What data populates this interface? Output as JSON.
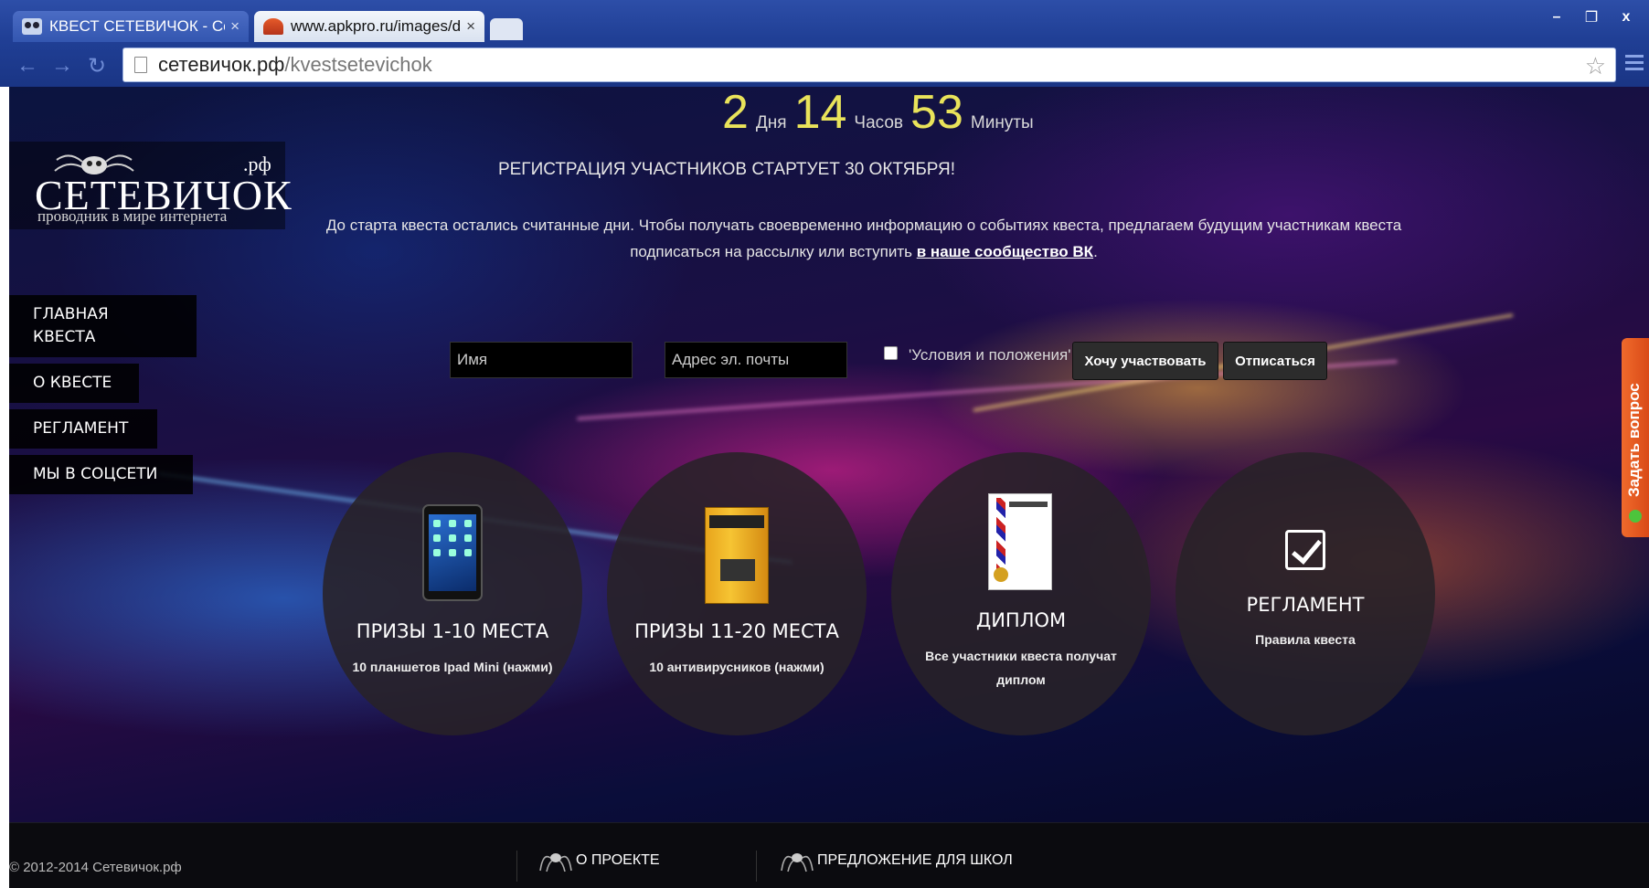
{
  "browser": {
    "tabs": [
      {
        "title": "КВЕСТ СЕТЕВИЧОК - Сет",
        "close": "×"
      },
      {
        "title": "www.apkpro.ru/images/d",
        "close": "×"
      }
    ],
    "window_buttons": {
      "minimize": "–",
      "restore": "❐",
      "close": "x"
    },
    "nav": {
      "back": "←",
      "forward": "→",
      "reload": "↻"
    },
    "url_host": "сетевичок.рф",
    "url_path": "/kvestsetevichok",
    "bookmark_star": "☆"
  },
  "countdown": {
    "days": "2",
    "days_label": "Дня",
    "hours": "14",
    "hours_label": "Часов",
    "minutes": "53",
    "minutes_label": "Минуты"
  },
  "registration_title": "РЕГИСТРАЦИЯ УЧАСТНИКОВ СТАРТУЕТ 30 ОКТЯБРЯ!",
  "intro": {
    "text": "До старта квеста остались считанные дни. Чтобы получать своевременно информацию о событиях квеста, предлагаем будущим участникам квеста подписаться на рассылку или вступить ",
    "link": "в наше сообщество ВК",
    "end": "."
  },
  "logo": {
    "name": "СЕТЕВИЧОК",
    "tld": ".рф",
    "tagline": "проводник в мире интернета"
  },
  "sidenav": [
    {
      "label": "ГЛАВНАЯ КВЕСТА"
    },
    {
      "label": "О КВЕСТЕ"
    },
    {
      "label": "РЕГЛАМЕНТ"
    },
    {
      "label": "МЫ В СОЦСЕТИ"
    }
  ],
  "form": {
    "name_placeholder": "Имя",
    "email_placeholder": "Адрес эл. почты",
    "terms_label": "'Условия и положения'",
    "submit_label": "Хочу участвовать",
    "unsubscribe_label": "Отписаться"
  },
  "features": [
    {
      "title": "ПРИЗЫ 1-10 МЕСТА",
      "desc": "10 планшетов Ipad Mini (нажми)",
      "icon": "ipad-icon"
    },
    {
      "title": "ПРИЗЫ 11-20 МЕСТА",
      "desc": "10 антивирусников (нажми)",
      "icon": "antivirus-box-icon"
    },
    {
      "title": "ДИПЛОМ",
      "desc": "Все участники квеста получат диплом",
      "icon": "diploma-icon"
    },
    {
      "title": "РЕГЛАМЕНТ",
      "desc": "Правила квеста",
      "icon": "checkbox-icon"
    }
  ],
  "feedback_tab": {
    "label": "Задать вопрос"
  },
  "footer": {
    "copyright": "© 2012-2014 Сетевичок.рф",
    "links": [
      {
        "label": "О ПРОЕКТЕ"
      },
      {
        "label": "ПРЕДЛОЖЕНИЕ ДЛЯ ШКОЛ"
      }
    ]
  },
  "colors": {
    "countdown": "#e9e35a",
    "feedback_tab": "#e85a22",
    "nav_bg": "#000000"
  }
}
